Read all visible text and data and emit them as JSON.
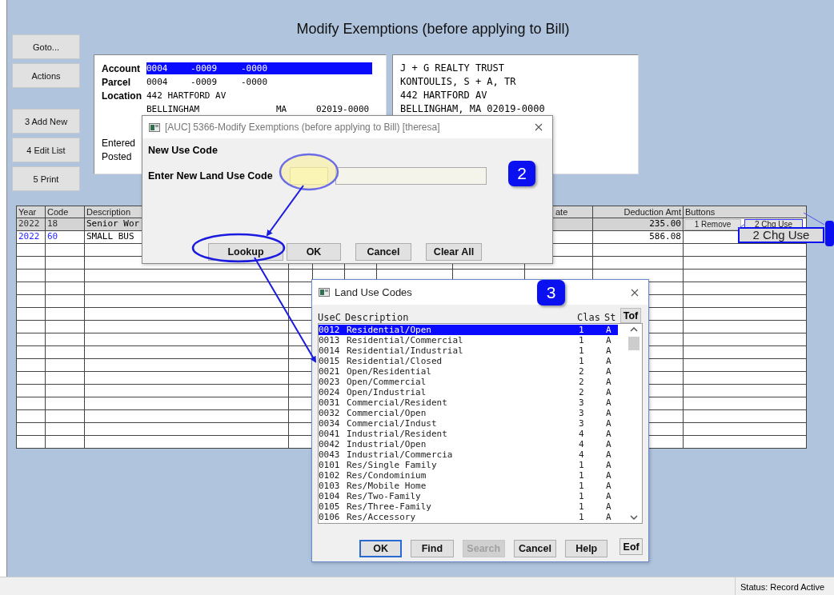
{
  "main_window": {
    "title": "Modify Exemptions (before applying to Bill)"
  },
  "side_buttons": [
    "Goto...",
    "Actions",
    "3 Add New",
    "4 Edit List",
    "5 Print"
  ],
  "account_panel": {
    "rows": [
      {
        "label": "Account",
        "values": [
          "0004",
          "-0009",
          "-0000"
        ],
        "selected": true
      },
      {
        "label": "Parcel",
        "values": [
          "0004",
          "-0009",
          "-0000"
        ],
        "selected": false
      },
      {
        "label": "Location",
        "values": [
          "442 HARTFORD AV"
        ],
        "selected": false
      },
      {
        "values": [
          "BELLINGHAM",
          "MA",
          "02019-0000"
        ],
        "selected": false
      }
    ],
    "date_labels": [
      "Entered",
      "Posted"
    ]
  },
  "owner_panel": {
    "lines": [
      "J + G REALTY TRUST",
      "KONTOULIS, S + A, TR",
      "442 HARTFORD AV",
      "BELLINGHAM, MA 02019-0000"
    ]
  },
  "exemptions_table": {
    "columns": {
      "year": "Year",
      "code": "Code",
      "description": "Description",
      "column_9": "ate",
      "deduction_amt": "Deduction Amt",
      "buttons": "Buttons"
    },
    "rows": [
      {
        "year": "2022",
        "code": "18",
        "description": "Senior Wor",
        "deduction_amt": "235.00",
        "selected": true,
        "color": "#333333",
        "buttons": [
          "1 Remove",
          "2 Chg Use"
        ]
      },
      {
        "year": "2022",
        "code": "60",
        "description": "SMALL BUS",
        "deduction_amt": "586.08",
        "selected": false,
        "color": "#2a2aff"
      }
    ]
  },
  "callout": {
    "label": "2 Chg Use"
  },
  "use_code_dialog": {
    "title": "[AUC] 5366-Modify Exemptions (before applying to Bill) [theresa]",
    "heading": "New Use Code",
    "prompt": "Enter New Land Use Code",
    "step_badge": "2",
    "buttons": [
      "Lookup",
      "OK",
      "Cancel",
      "Clear All"
    ]
  },
  "land_use_dialog": {
    "title": "Land Use Codes",
    "step_badge": "3",
    "columns": [
      "UseC",
      "Description",
      "Clas",
      "St"
    ],
    "top_button": "Tof",
    "rows": [
      {
        "code": "0012",
        "description": "Residential/Open",
        "class": "1",
        "status": "A",
        "selected": true
      },
      {
        "code": "0013",
        "description": "Residential/Commercial",
        "class": "1",
        "status": "A",
        "selected": false
      },
      {
        "code": "0014",
        "description": "Residential/Industrial",
        "class": "1",
        "status": "A",
        "selected": false
      },
      {
        "code": "0015",
        "description": "Residential/Closed",
        "class": "1",
        "status": "A",
        "selected": false
      },
      {
        "code": "0021",
        "description": "Open/Residential",
        "class": "2",
        "status": "A",
        "selected": false
      },
      {
        "code": "0023",
        "description": "Open/Commercial",
        "class": "2",
        "status": "A",
        "selected": false
      },
      {
        "code": "0024",
        "description": "Open/Industrial",
        "class": "2",
        "status": "A",
        "selected": false
      },
      {
        "code": "0031",
        "description": "Commercial/Resident",
        "class": "3",
        "status": "A",
        "selected": false
      },
      {
        "code": "0032",
        "description": "Commercial/Open",
        "class": "3",
        "status": "A",
        "selected": false
      },
      {
        "code": "0034",
        "description": "Commercial/Indust",
        "class": "3",
        "status": "A",
        "selected": false
      },
      {
        "code": "0041",
        "description": "Industrial/Resident",
        "class": "4",
        "status": "A",
        "selected": false
      },
      {
        "code": "0042",
        "description": "Industrial/Open",
        "class": "4",
        "status": "A",
        "selected": false
      },
      {
        "code": "0043",
        "description": "Industrial/Commercia",
        "class": "4",
        "status": "A",
        "selected": false
      },
      {
        "code": "0101",
        "description": "Res/Single Family",
        "class": "1",
        "status": "A",
        "selected": false
      },
      {
        "code": "0102",
        "description": "Res/Condominium",
        "class": "1",
        "status": "A",
        "selected": false
      },
      {
        "code": "0103",
        "description": "Res/Mobile Home",
        "class": "1",
        "status": "A",
        "selected": false
      },
      {
        "code": "0104",
        "description": "Res/Two-Family",
        "class": "1",
        "status": "A",
        "selected": false
      },
      {
        "code": "0105",
        "description": "Res/Three-Family",
        "class": "1",
        "status": "A",
        "selected": false
      },
      {
        "code": "0106",
        "description": "Res/Accessory",
        "class": "1",
        "status": "A",
        "selected": false
      }
    ],
    "buttons": [
      {
        "label": "OK",
        "default": true,
        "disabled": false
      },
      {
        "label": "Find",
        "default": false,
        "disabled": false
      },
      {
        "label": "Search",
        "default": false,
        "disabled": true
      },
      {
        "label": "Cancel",
        "default": false,
        "disabled": false
      },
      {
        "label": "Help",
        "default": false,
        "disabled": false
      }
    ],
    "end_button": "Eof"
  },
  "status_bar": {
    "text": "Status: Record Active"
  }
}
